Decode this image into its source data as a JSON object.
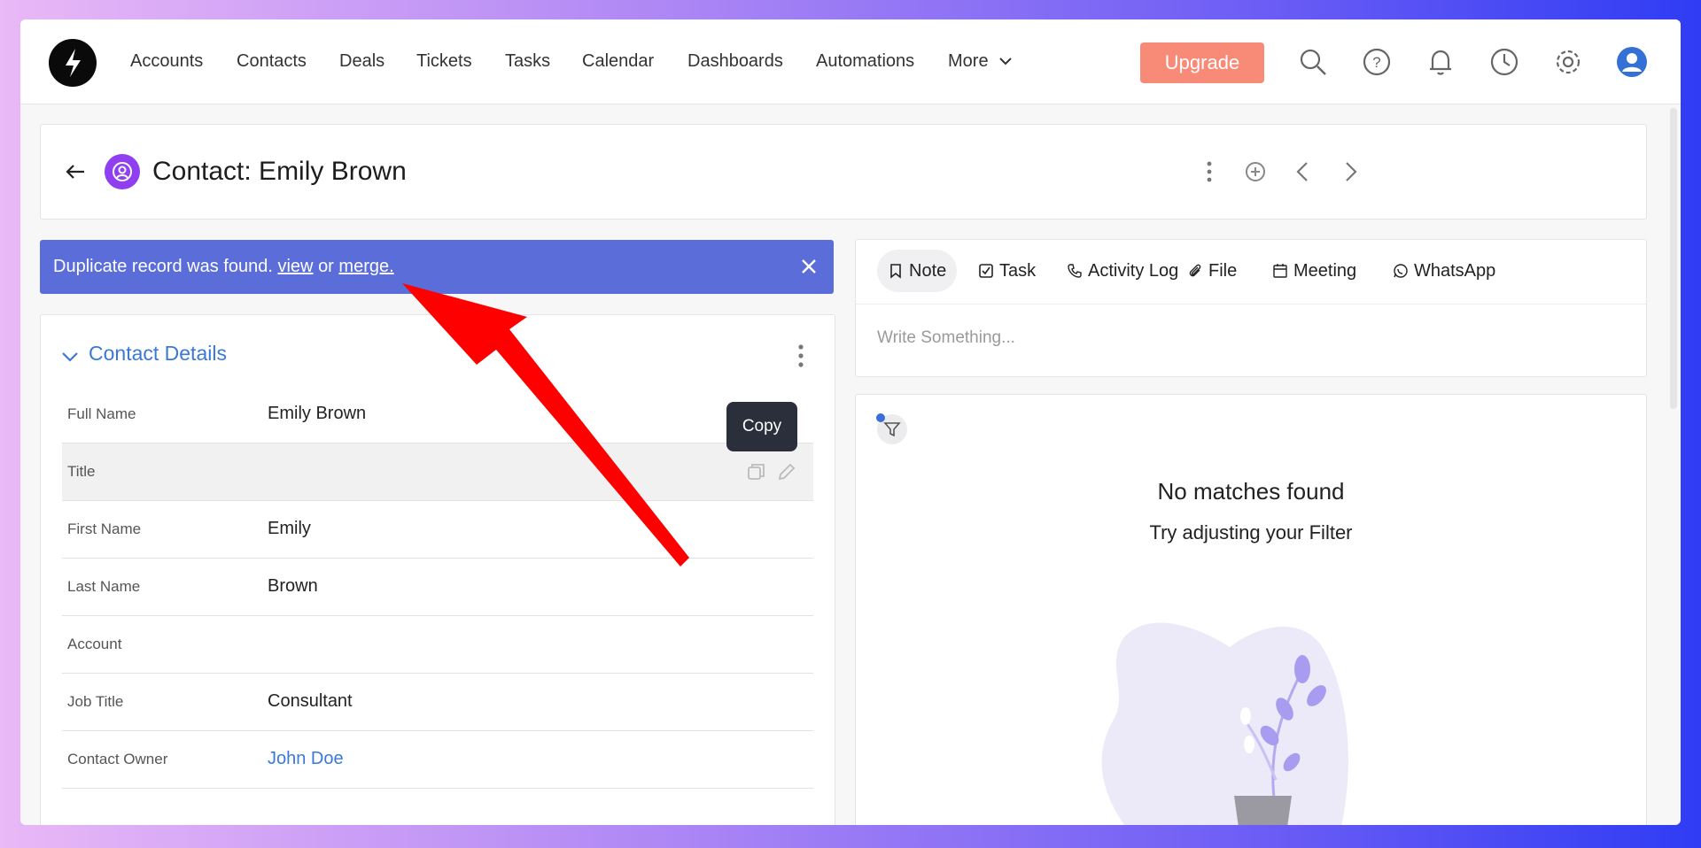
{
  "nav": {
    "items": [
      "Accounts",
      "Contacts",
      "Deals",
      "Tickets",
      "Tasks",
      "Calendar",
      "Dashboards",
      "Automations"
    ],
    "more_label": "More",
    "upgrade_label": "Upgrade",
    "icons": [
      "search-icon",
      "help-icon",
      "bell-icon",
      "clock-icon",
      "gear-icon",
      "user-avatar-icon"
    ]
  },
  "header": {
    "title": "Contact: Emily Brown"
  },
  "banner": {
    "text": "Duplicate record was found.",
    "view_link": "view",
    "or_text": "or",
    "merge_link": "merge."
  },
  "details": {
    "section_title": "Contact Details",
    "fields": [
      {
        "label": "Full Name",
        "value": "Emily Brown"
      },
      {
        "label": "Title",
        "value": ""
      },
      {
        "label": "First Name",
        "value": "Emily"
      },
      {
        "label": "Last Name",
        "value": "Brown"
      },
      {
        "label": "Account",
        "value": ""
      },
      {
        "label": "Job Title",
        "value": "Consultant"
      },
      {
        "label": "Contact Owner",
        "value": "John Doe"
      }
    ],
    "tooltip": "Copy"
  },
  "composer": {
    "tabs": [
      "Note",
      "Task",
      "Activity Log",
      "File",
      "Meeting",
      "WhatsApp"
    ],
    "placeholder": "Write Something..."
  },
  "activity": {
    "empty_title": "No matches found",
    "empty_subtitle": "Try adjusting your Filter"
  },
  "colors": {
    "accent": "#3a79d8",
    "banner": "#5a6dd8",
    "upgrade": "#f88b78",
    "contact_badge": "#8f3ff0",
    "annotation_arrow": "#ff0000"
  }
}
